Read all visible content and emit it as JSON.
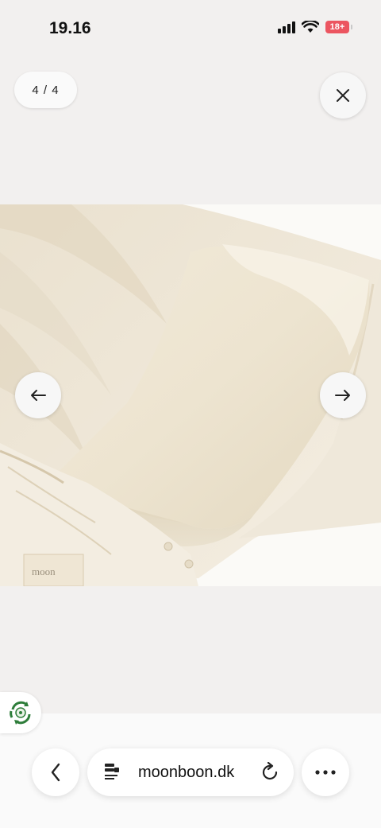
{
  "status_bar": {
    "time": "19.16",
    "battery_label": "18+"
  },
  "viewer": {
    "counter": "4 / 4",
    "image_label": "moon"
  },
  "browser": {
    "url": "moonboon.dk"
  },
  "colors": {
    "background": "#f2f0ef",
    "battery": "#ec5560",
    "eco_green": "#2e7d3a"
  },
  "icons": {
    "close": "close-icon",
    "prev": "arrow-left-icon",
    "next": "arrow-right-icon",
    "back": "chevron-left-icon",
    "page": "page-info-icon",
    "reload": "reload-icon",
    "more": "ellipsis-icon",
    "eco": "recycle-leaf-icon"
  }
}
